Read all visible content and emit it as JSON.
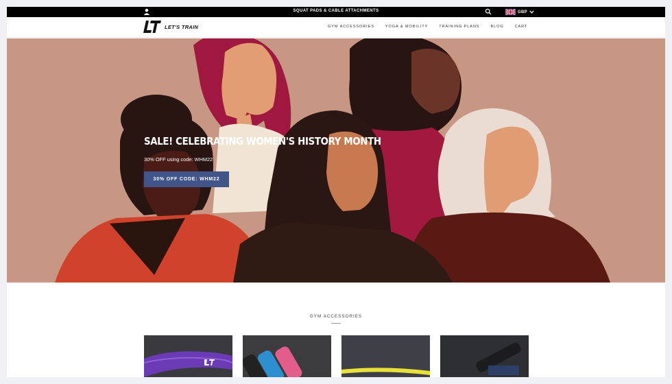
{
  "topbar": {
    "announcement": "SQUAT PADS & CABLE ATTACHMENTS",
    "currency": "GBP",
    "icons": [
      "user-icon",
      "search-icon",
      "uk-flag-icon",
      "chevron-down-icon"
    ]
  },
  "header": {
    "logo_mark": "LT",
    "logo_text": "LET'S TRAIN",
    "nav": [
      "GYM ACCESSORIES",
      "YOGA & MOBILITY",
      "TRAINING PLANS",
      "BLOG",
      "CART"
    ]
  },
  "hero": {
    "title": "SALE! CELEBRATING WOMEN'S HISTORY MONTH",
    "subtitle": "30% OFF using code: WHM22",
    "button_label": "30% OFF CODE: WHM22",
    "colors": {
      "background": "#c79784",
      "button": "#41558a"
    }
  },
  "section": {
    "title": "GYM ACCESSORIES",
    "products": [
      {
        "name": "resistance-band",
        "logo_mark": "LT"
      },
      {
        "name": "foam-rollers"
      },
      {
        "name": "yellow-band"
      },
      {
        "name": "barbell-pad"
      }
    ]
  }
}
